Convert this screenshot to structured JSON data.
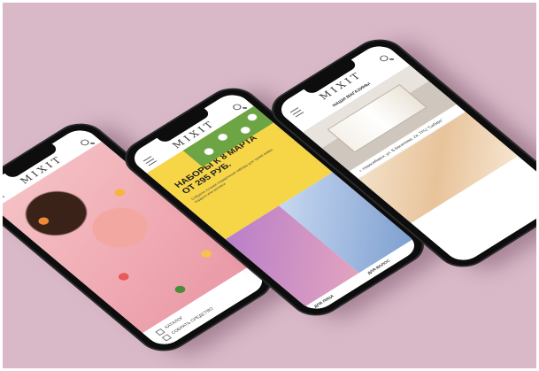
{
  "phones": {
    "phone1": {
      "logo": "MIXIT",
      "bottom_bar": {
        "catalog": "КАТАЛОГ",
        "compare": "СОБРАТЬ СРЕДСТВО"
      }
    },
    "phone2": {
      "logo": "MIXIT",
      "promo_title": "НАБОРЫ К 8 МАРТА ОТ 295 РУБ.",
      "promo_text": "Собрали лучшие подарочные наборы для твоей мамы, подруги или коллеги",
      "tile_left_label": "ДЛЯ ЛИЦА",
      "tile_right_label": "ДЛЯ ВОЛОС"
    },
    "phone3": {
      "logo": "MIXIT",
      "section_title": "НАШИ МАГАЗИНЫ",
      "store_address": "г. Новосибирск, ул. Б.Богаткова, 2а, ТРЦ \"Сибирь\""
    }
  },
  "colors": {
    "background": "#d9b9c8",
    "accent": "#d64b8a",
    "promo_yellow": "#f6d547"
  }
}
